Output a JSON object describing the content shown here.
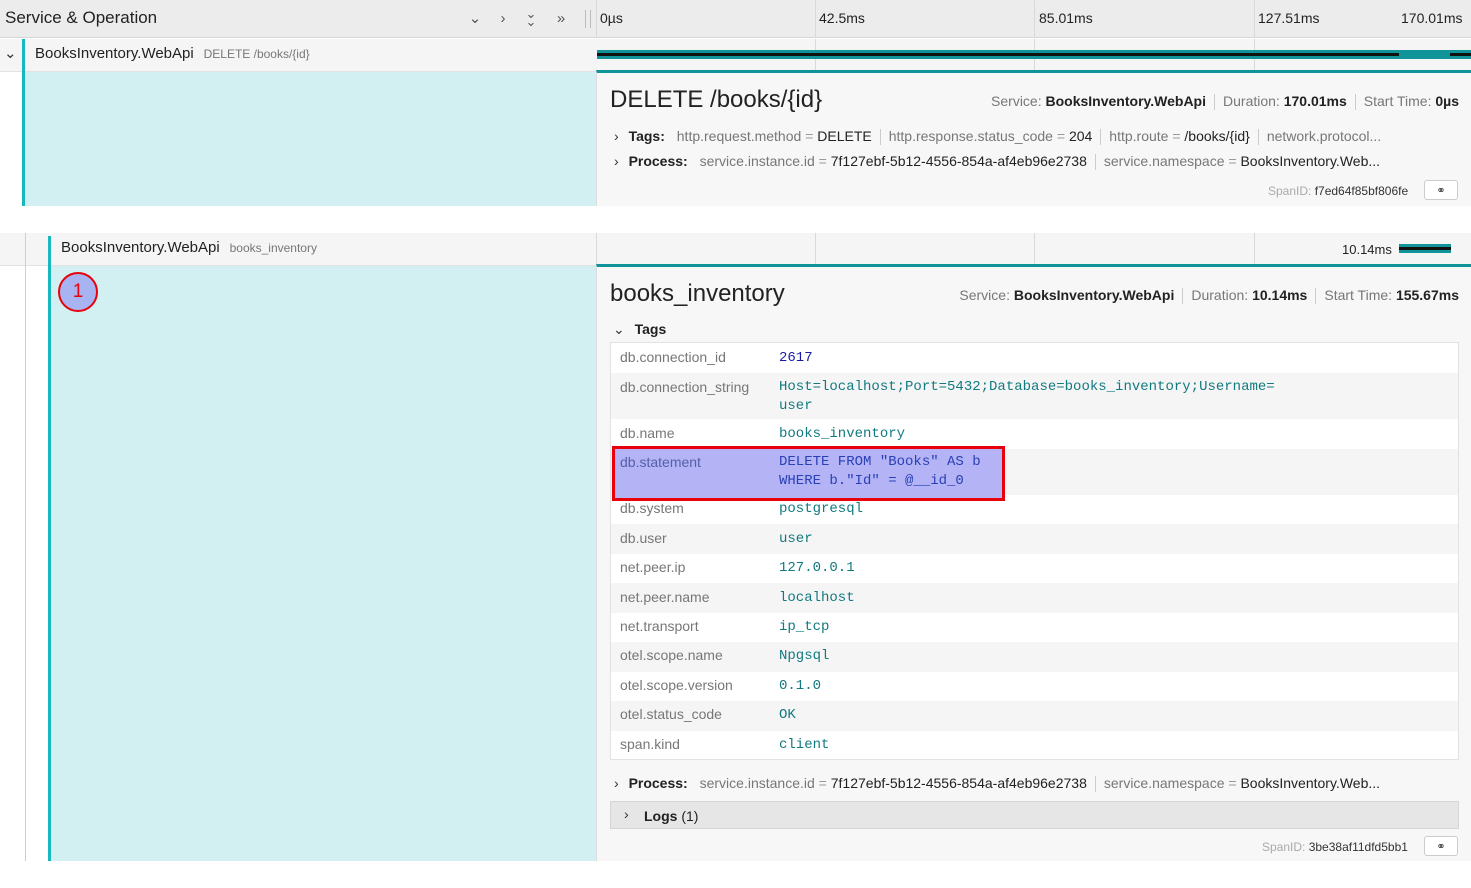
{
  "header": {
    "title": "Service & Operation",
    "ticks": [
      "0µs",
      "42.5ms",
      "85.01ms",
      "127.51ms",
      "170.01ms"
    ],
    "buttons": [
      "collapse-one",
      "expand-one",
      "collapse-all",
      "expand-all"
    ]
  },
  "span1": {
    "service": "BooksInventory.WebApi",
    "operation": "DELETE /books/{id}",
    "detail": {
      "title": "DELETE /books/{id}",
      "service_label": "Service:",
      "service": "BooksInventory.WebApi",
      "duration_label": "Duration:",
      "duration": "170.01ms",
      "start_label": "Start Time:",
      "start": "0µs",
      "tags_label": "Tags:",
      "tags": [
        {
          "k": "http.request.method",
          "v": "DELETE"
        },
        {
          "k": "http.response.status_code",
          "v": "204"
        },
        {
          "k": "http.route",
          "v": "/books/{id}"
        },
        {
          "k": "network.protocol...",
          "v": ""
        }
      ],
      "process_label": "Process:",
      "process": [
        {
          "k": "service.instance.id",
          "v": "7f127ebf-5b12-4556-854a-af4eb96e2738"
        },
        {
          "k": "service.namespace",
          "v": "BooksInventory.Web..."
        }
      ],
      "spanid_label": "SpanID:",
      "spanid": "f7ed64f85bf806fe"
    }
  },
  "span2": {
    "service": "BooksInventory.WebApi",
    "operation": "books_inventory",
    "bar_label": "10.14ms",
    "marker": "1",
    "detail": {
      "title": "books_inventory",
      "service_label": "Service:",
      "service": "BooksInventory.WebApi",
      "duration_label": "Duration:",
      "duration": "10.14ms",
      "start_label": "Start Time:",
      "start": "155.67ms",
      "tags_label": "Tags",
      "tags": [
        {
          "k": "db.connection_id",
          "v": "2617"
        },
        {
          "k": "db.connection_string",
          "v": "Host=localhost;Port=5432;Database=books_inventory;Username=\nuser"
        },
        {
          "k": "db.name",
          "v": "books_inventory"
        },
        {
          "k": "db.statement",
          "v": "DELETE FROM \"Books\" AS b\nWHERE b.\"Id\" = @__id_0"
        },
        {
          "k": "db.system",
          "v": "postgresql"
        },
        {
          "k": "db.user",
          "v": "user"
        },
        {
          "k": "net.peer.ip",
          "v": "127.0.0.1"
        },
        {
          "k": "net.peer.name",
          "v": "localhost"
        },
        {
          "k": "net.transport",
          "v": "ip_tcp"
        },
        {
          "k": "otel.scope.name",
          "v": "Npgsql"
        },
        {
          "k": "otel.scope.version",
          "v": "0.1.0"
        },
        {
          "k": "otel.status_code",
          "v": "OK"
        },
        {
          "k": "span.kind",
          "v": "client"
        }
      ],
      "process_label": "Process:",
      "process": [
        {
          "k": "service.instance.id",
          "v": "7f127ebf-5b12-4556-854a-af4eb96e2738"
        },
        {
          "k": "service.namespace",
          "v": "BooksInventory.Web..."
        }
      ],
      "logs_label": "Logs",
      "logs_count": "(1)",
      "spanid_label": "SpanID:",
      "spanid": "3be38af11dfd5bb1"
    }
  },
  "colors": {
    "teal": "#17b8be",
    "teal_dark": "#11939a",
    "panel": "#d2f0f1",
    "highlight_fill": "#b3b3f5",
    "highlight_border": "#e8000b"
  }
}
